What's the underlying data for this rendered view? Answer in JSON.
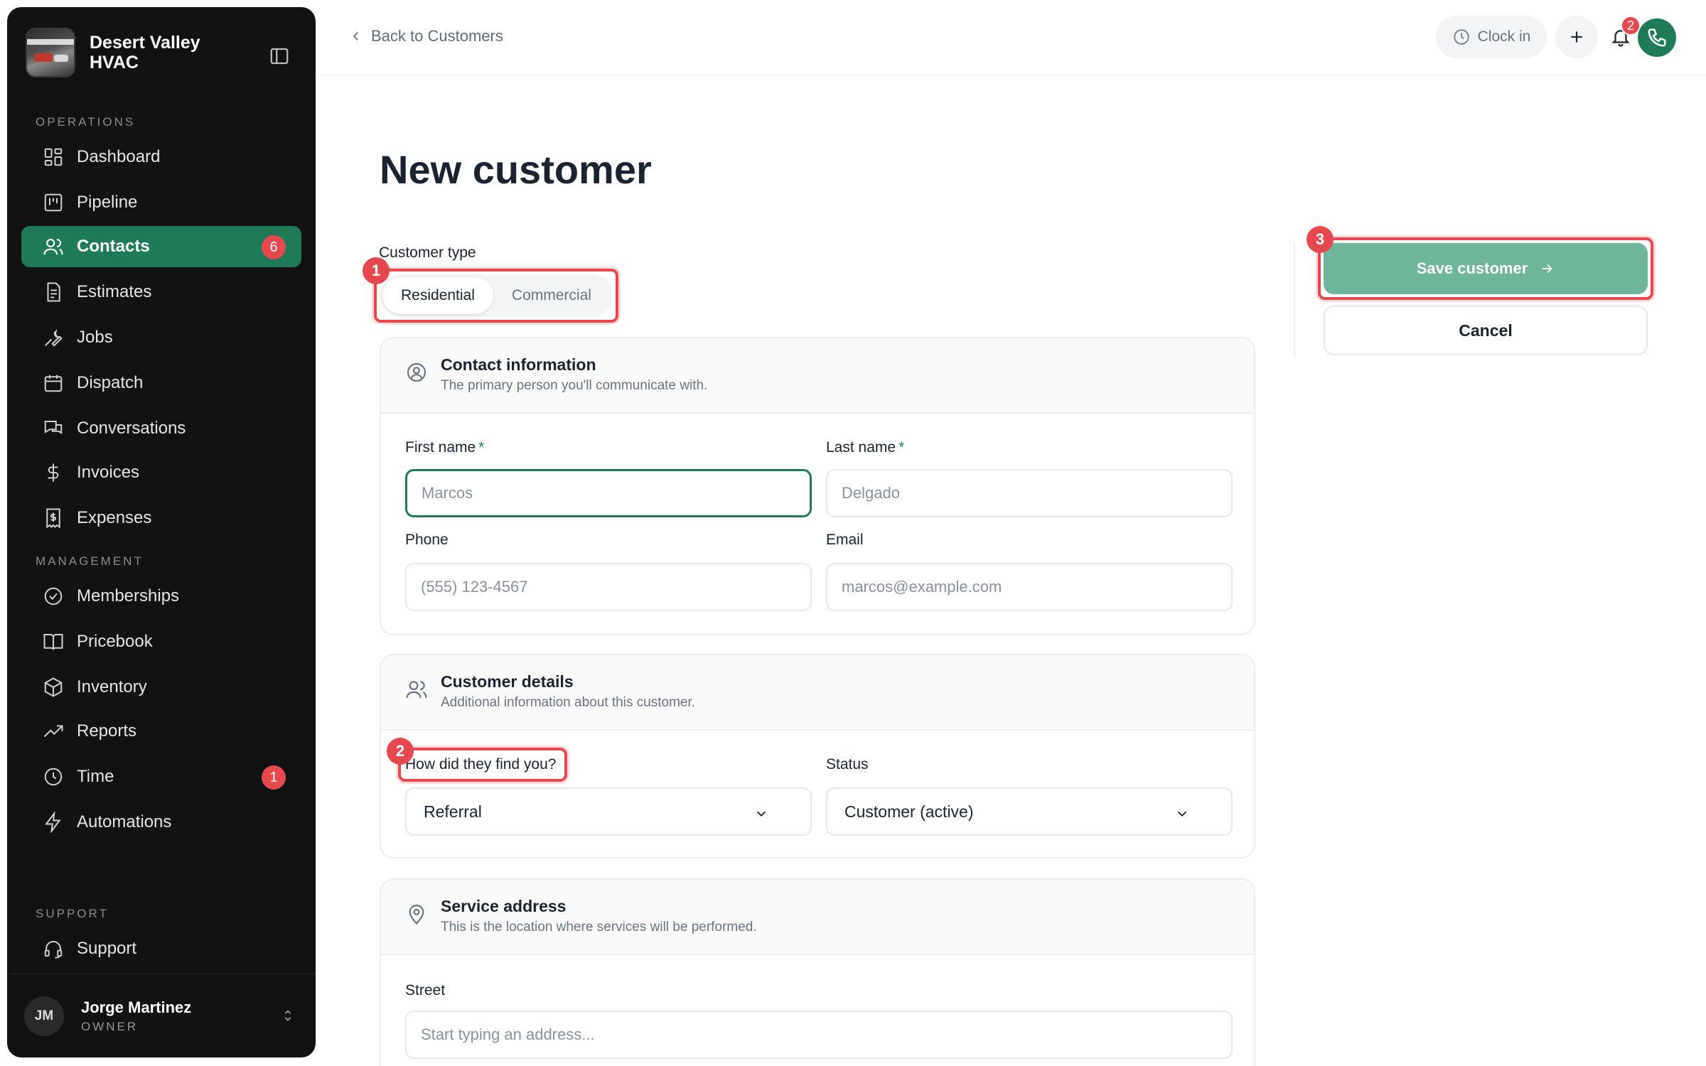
{
  "brand": {
    "name": "Desert Valley HVAC"
  },
  "sidebar": {
    "sections": {
      "operations": "OPERATIONS",
      "management": "MANAGEMENT",
      "support": "SUPPORT"
    },
    "items": [
      {
        "label": "Dashboard",
        "icon": "dashboard-icon"
      },
      {
        "label": "Pipeline",
        "icon": "pipeline-icon"
      },
      {
        "label": "Contacts",
        "icon": "contacts-icon",
        "active": true,
        "badge": "6"
      },
      {
        "label": "Estimates",
        "icon": "estimates-icon"
      },
      {
        "label": "Jobs",
        "icon": "wrench-icon"
      },
      {
        "label": "Dispatch",
        "icon": "calendar-icon"
      },
      {
        "label": "Conversations",
        "icon": "chat-icon"
      },
      {
        "label": "Invoices",
        "icon": "dollar-icon"
      },
      {
        "label": "Expenses",
        "icon": "receipt-icon"
      },
      {
        "label": "Memberships",
        "icon": "badge-check-icon"
      },
      {
        "label": "Pricebook",
        "icon": "book-icon"
      },
      {
        "label": "Inventory",
        "icon": "box-icon"
      },
      {
        "label": "Reports",
        "icon": "trend-icon"
      },
      {
        "label": "Time",
        "icon": "clock-icon",
        "badge": "1"
      },
      {
        "label": "Automations",
        "icon": "bolt-icon"
      },
      {
        "label": "Support",
        "icon": "headset-icon"
      }
    ],
    "user": {
      "initials": "JM",
      "name": "Jorge Martinez",
      "role": "OWNER"
    }
  },
  "topbar": {
    "back_label": "Back to Customers",
    "clock_label": "Clock in",
    "notifications_count": "2"
  },
  "page": {
    "title": "New customer"
  },
  "form": {
    "customer_type": {
      "label": "Customer type",
      "options": [
        "Residential",
        "Commercial"
      ],
      "selected": "Residential"
    },
    "contact": {
      "title": "Contact information",
      "subtitle": "The primary person you'll communicate with.",
      "first_name_label": "First name",
      "first_name_placeholder": "Marcos",
      "last_name_label": "Last name",
      "last_name_placeholder": "Delgado",
      "required_mark": "*",
      "phone_label": "Phone",
      "phone_placeholder": "(555) 123-4567",
      "email_label": "Email",
      "email_placeholder": "marcos@example.com"
    },
    "details": {
      "title": "Customer details",
      "subtitle": "Additional information about this customer.",
      "source_label": "How did they find you?",
      "source_value": "Referral",
      "status_label": "Status",
      "status_value": "Customer (active)"
    },
    "address": {
      "title": "Service address",
      "subtitle": "This is the location where services will be performed.",
      "street_label": "Street",
      "street_placeholder": "Start typing an address..."
    }
  },
  "actions": {
    "save_label": "Save customer",
    "cancel_label": "Cancel"
  },
  "annotations": [
    "1",
    "2",
    "3"
  ],
  "colors": {
    "accent": "#1f7a57",
    "highlight": "#e5484d",
    "save_disabled": "#6fb59a"
  }
}
